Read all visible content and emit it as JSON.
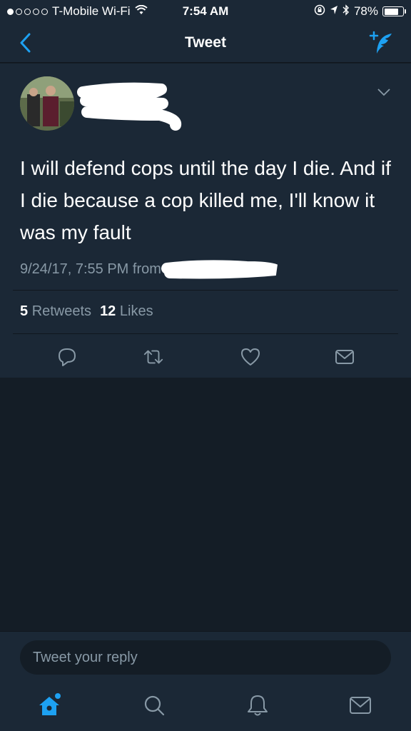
{
  "status_bar": {
    "carrier": "T-Mobile Wi-Fi",
    "time": "7:54 AM",
    "battery": "78%",
    "battery_level": 0.78,
    "signal_bars_filled": 1,
    "signal_bars_total": 5
  },
  "nav": {
    "title": "Tweet",
    "back_icon": "chevron-left-icon",
    "compose_icon": "compose-tweet-icon"
  },
  "tweet": {
    "text": "I will defend cops until the day I die. And if I die because a cop killed me, I'll know it was my fault",
    "timestamp": "9/24/17, 7:55 PM from",
    "retweets_count": "5",
    "retweets_label": "Retweets",
    "likes_count": "12",
    "likes_label": "Likes"
  },
  "actions": [
    "reply-icon",
    "retweet-icon",
    "like-icon",
    "message-icon"
  ],
  "reply": {
    "placeholder": "Tweet your reply"
  },
  "tabs": [
    "home-icon",
    "search-icon",
    "notifications-icon",
    "messages-icon"
  ],
  "colors": {
    "accent": "#1da1f2",
    "background": "#141d26",
    "surface": "#1b2836",
    "secondary_text": "#8899a6",
    "divider": "#10171e"
  }
}
